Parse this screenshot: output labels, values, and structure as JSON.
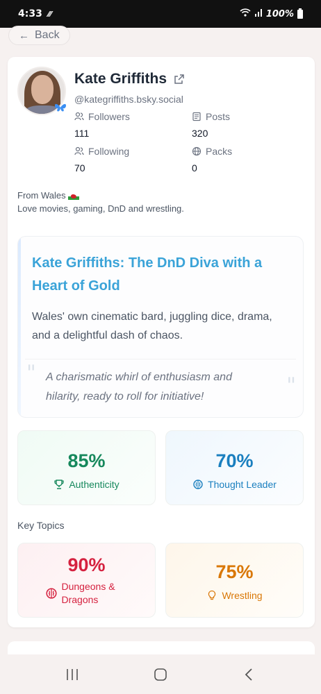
{
  "status_bar": {
    "time": "4:33",
    "battery": "100%"
  },
  "back": {
    "label": "Back"
  },
  "profile": {
    "name": "Kate Griffiths",
    "handle": "@kategriffiths.bsky.social",
    "stats": {
      "followers": {
        "label": "Followers",
        "value": "111"
      },
      "posts": {
        "label": "Posts",
        "value": "320"
      },
      "following": {
        "label": "Following",
        "value": "70"
      },
      "packs": {
        "label": "Packs",
        "value": "0"
      }
    },
    "bio_line1": "From Wales",
    "bio_line2": "Love movies, gaming, DnD and wrestling."
  },
  "summary": {
    "title": "Kate Griffiths: The DnD Diva with a Heart of Gold",
    "description": "Wales' own cinematic bard, juggling dice, drama, and a delightful dash of chaos.",
    "quote": "A charismatic whirl of enthusiasm and hilarity, ready to roll for initiative!"
  },
  "metrics": [
    {
      "value": "85%",
      "label": "Authenticity",
      "icon": "trophy-icon",
      "color": "#16885c"
    },
    {
      "value": "70%",
      "label": "Thought Leader",
      "icon": "brain-icon",
      "color": "#1a7fbf"
    }
  ],
  "key_topics": {
    "heading": "Key Topics",
    "items": [
      {
        "value": "90%",
        "label": "Dungeons & Dragons",
        "icon": "brain-icon",
        "color": "#d5213f"
      },
      {
        "value": "75%",
        "label": "Wrestling",
        "icon": "lightbulb-icon",
        "color": "#d97706"
      }
    ]
  },
  "colors": {
    "accent": "#3aa3d8",
    "bluesky": "#3b8ff3"
  }
}
